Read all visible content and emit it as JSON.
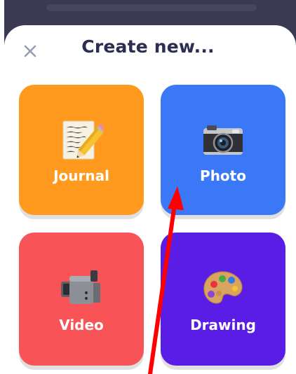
{
  "header": {
    "title": "Create new..."
  },
  "close_button": {
    "icon": "close-icon"
  },
  "tiles": [
    {
      "label": "Journal",
      "icon": "journal-notepad-icon",
      "color": "#ff9a1f"
    },
    {
      "label": "Photo",
      "icon": "camera-icon",
      "color": "#3a78f7"
    },
    {
      "label": "Video",
      "icon": "video-camera-icon",
      "color": "#f85457"
    },
    {
      "label": "Drawing",
      "icon": "paint-palette-icon",
      "color": "#5a1de6"
    }
  ],
  "annotation": {
    "arrow_color": "#ff0000"
  }
}
